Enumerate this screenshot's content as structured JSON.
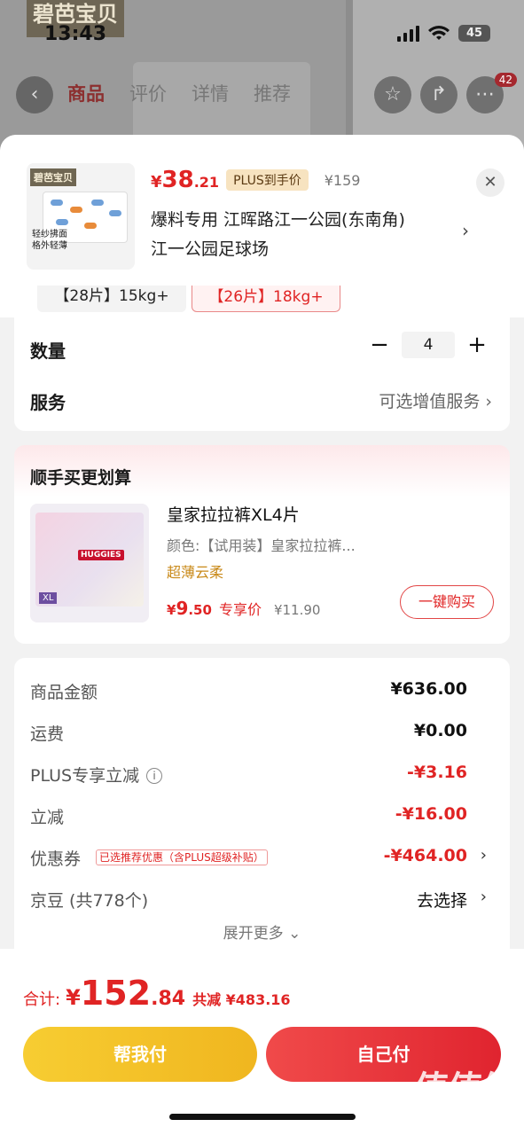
{
  "status_bar": {
    "time": "13:43",
    "battery": "45"
  },
  "background_page": {
    "brand": "碧芭宝贝",
    "tabs": [
      "商品",
      "评价",
      "详情",
      "推荐"
    ],
    "cart_badge": "42"
  },
  "sheet": {
    "price_yen": "¥",
    "price_int": "38",
    "price_dec": ".21",
    "plus_tag": "PLUS到手价",
    "original_price": "¥159",
    "thumb_brand": "碧芭宝贝",
    "thumb_caption_1": "轻纱拂面",
    "thumb_caption_2": "格外轻薄",
    "address_line1": "爆料专用  江晖路江一公园(东南角)",
    "address_line2": "江一公园足球场",
    "specs": [
      "【28片】15kg+",
      "【26片】18kg+"
    ]
  },
  "quantity": {
    "label": "数量",
    "value": "4",
    "minus": "−",
    "plus": "+"
  },
  "service": {
    "label": "服务",
    "value": "可选增值服务"
  },
  "bundle": {
    "title": "顺手买更划算",
    "name": "皇家拉拉裤XL4片",
    "desc": "颜色:【试用装】皇家拉拉裤...",
    "tag": "超薄云柔",
    "price_yen": "¥",
    "price_int": "9",
    "price_dec": ".50",
    "price_label": "专享价",
    "orig_price": "¥11.90",
    "buy_button": "一键购买"
  },
  "summary": {
    "rows": [
      {
        "k": "商品金额",
        "v": "¥636.00"
      },
      {
        "k": "运费",
        "v": "¥0.00"
      },
      {
        "k": "PLUS专享立减",
        "v": "-¥3.16"
      },
      {
        "k": "立减",
        "v": "-¥16.00"
      },
      {
        "k": "优惠券",
        "v": "-¥464.00",
        "tag": "已选推荐优惠（含PLUS超级补贴）"
      },
      {
        "k": "京豆 (共778个)",
        "v": "去选择"
      }
    ],
    "expand": "展开更多"
  },
  "footer": {
    "total_label": "合计:",
    "total_yen": "¥",
    "total_int": "152",
    "total_dec": ".84",
    "save_text": "共减 ¥483.16",
    "help_pay": "帮我付",
    "self_pay": "自己付",
    "watermark": "值值值",
    "watermark_url": "zhizhizhi.com"
  },
  "colors": {
    "accent": "#e02424",
    "plus_tag_bg": "#f7e3c0",
    "help_btn": "#f3c22b"
  }
}
